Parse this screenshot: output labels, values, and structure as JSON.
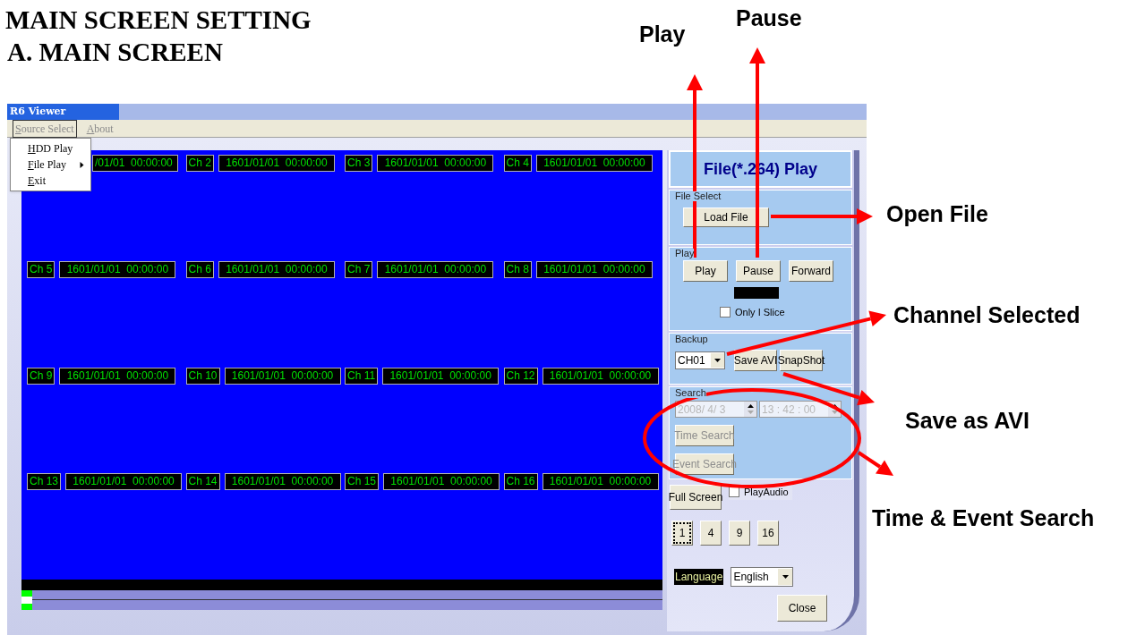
{
  "heading": {
    "title": "MAIN SCREEN SETTING",
    "subtitle": "A. MAIN SCREEN"
  },
  "window": {
    "title": "R6 Viewer"
  },
  "menu_bar": [
    {
      "label": "Source Select",
      "selected": true
    },
    {
      "label": "About",
      "selected": false
    }
  ],
  "dropdown": [
    {
      "label": "HDD Play",
      "submenu": false
    },
    {
      "label": "File Play",
      "submenu": true
    },
    {
      "label": "Exit",
      "submenu": false
    }
  ],
  "channels": [
    {
      "time": "/01/01  00:00:00"
    },
    {
      "label": "Ch 2",
      "time": "1601/01/01  00:00:00"
    },
    {
      "label": "Ch 3",
      "time": "1601/01/01  00:00:00"
    },
    {
      "label": "Ch 4",
      "time": "1601/01/01  00:00:00"
    },
    {
      "label": "Ch 5",
      "time": "1601/01/01  00:00:00"
    },
    {
      "label": "Ch 6",
      "time": "1601/01/01  00:00:00"
    },
    {
      "label": "Ch 7",
      "time": "1601/01/01  00:00:00"
    },
    {
      "label": "Ch 8",
      "time": "1601/01/01  00:00:00"
    },
    {
      "label": "Ch 9",
      "time": "1601/01/01  00:00:00"
    },
    {
      "label": "Ch 10",
      "time": "1601/01/01  00:00:00"
    },
    {
      "label": "Ch 11",
      "time": "1601/01/01  00:00:00"
    },
    {
      "label": "Ch 12",
      "time": "1601/01/01  00:00:00"
    },
    {
      "label": "Ch 13",
      "time": "1601/01/01  00:00:00"
    },
    {
      "label": "Ch 14",
      "time": "1601/01/01  00:00:00"
    },
    {
      "label": "Ch 15",
      "time": "1601/01/01  00:00:00"
    },
    {
      "label": "Ch 16",
      "time": "1601/01/01  00:00:00"
    }
  ],
  "panel": {
    "title": "File(*.264) Play",
    "file_select": {
      "legend": "File Select",
      "button": "Load File"
    },
    "play": {
      "legend": "Play",
      "buttons": [
        "Play",
        "Pause",
        "Forward"
      ],
      "only_i_slice": {
        "label": "Only I Slice",
        "checked": false
      }
    },
    "backup": {
      "legend": "Backup",
      "channel": "CH01",
      "buttons": [
        "Save AVI",
        "SnapShot"
      ]
    },
    "search": {
      "legend": "Search",
      "date": "2008/ 4/ 3",
      "time": "13 : 42 : 00",
      "buttons": [
        "Time Search",
        "Event Search"
      ],
      "disabled": true
    },
    "full_screen": "Full Screen",
    "play_audio": {
      "label": "PlayAudio",
      "checked": false
    },
    "layouts": [
      {
        "label": "1",
        "selected": true
      },
      {
        "label": "4",
        "selected": false
      },
      {
        "label": "9",
        "selected": false
      },
      {
        "label": "16",
        "selected": false
      }
    ],
    "language": {
      "label": "Language",
      "value": "English"
    },
    "close": "Close"
  },
  "annotations": [
    {
      "text": "Play"
    },
    {
      "text": "Pause"
    },
    {
      "text": "Open File"
    },
    {
      "text": "Channel Selected"
    },
    {
      "text": "Save as AVI"
    },
    {
      "text": "Time & Event Search"
    }
  ]
}
